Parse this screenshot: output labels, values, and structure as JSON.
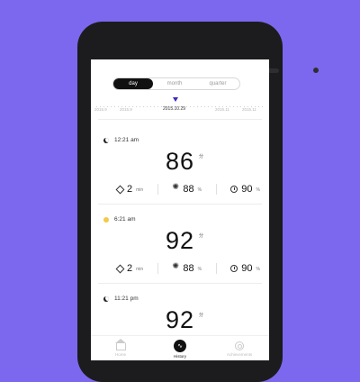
{
  "tabs": [
    {
      "label": "day",
      "active": true
    },
    {
      "label": "month",
      "active": false
    },
    {
      "label": "quarter",
      "active": false
    }
  ],
  "timeline": {
    "labels": [
      "2015.9",
      "2015.9",
      "2015.10.29",
      "2015.11",
      "2015.11"
    ],
    "current": "2015.10.29"
  },
  "entries": [
    {
      "time": "12:21 am",
      "period_icon": "moon-icon",
      "score": "86",
      "score_unit": "分",
      "duration": "2",
      "duration_unit": "min",
      "humidity": "88",
      "humidity_unit": "%",
      "efficiency": "90",
      "efficiency_unit": "%"
    },
    {
      "time": "6:21 am",
      "period_icon": "sun-icon",
      "score": "92",
      "score_unit": "分",
      "duration": "2",
      "duration_unit": "min",
      "humidity": "88",
      "humidity_unit": "%",
      "efficiency": "90",
      "efficiency_unit": "%"
    },
    {
      "time": "11:21 pm",
      "period_icon": "moon-icon",
      "score": "92",
      "score_unit": "分"
    }
  ],
  "nav": [
    {
      "label": "Home",
      "icon": "home-icon",
      "active": false
    },
    {
      "label": "History",
      "icon": "history-icon",
      "active": true
    },
    {
      "label": "Achievements",
      "icon": "gear-icon",
      "active": false
    }
  ],
  "colors": {
    "background": "#7b68ee",
    "phone": "#1c1c1e",
    "accent": "#3a2bbf",
    "sun": "#f3c94a"
  }
}
